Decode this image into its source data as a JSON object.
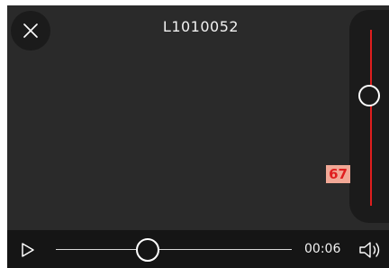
{
  "viewer": {
    "file_name": "L1010052",
    "close_icon": "close-icon"
  },
  "volume": {
    "value": "67",
    "level_fraction": 0.67,
    "track_color": "#e01e1e",
    "badge_color": "#f2a896"
  },
  "playback": {
    "play_icon": "play-icon",
    "position_fraction": 0.42,
    "time": "00:06",
    "speaker_icon": "speaker-icon"
  }
}
